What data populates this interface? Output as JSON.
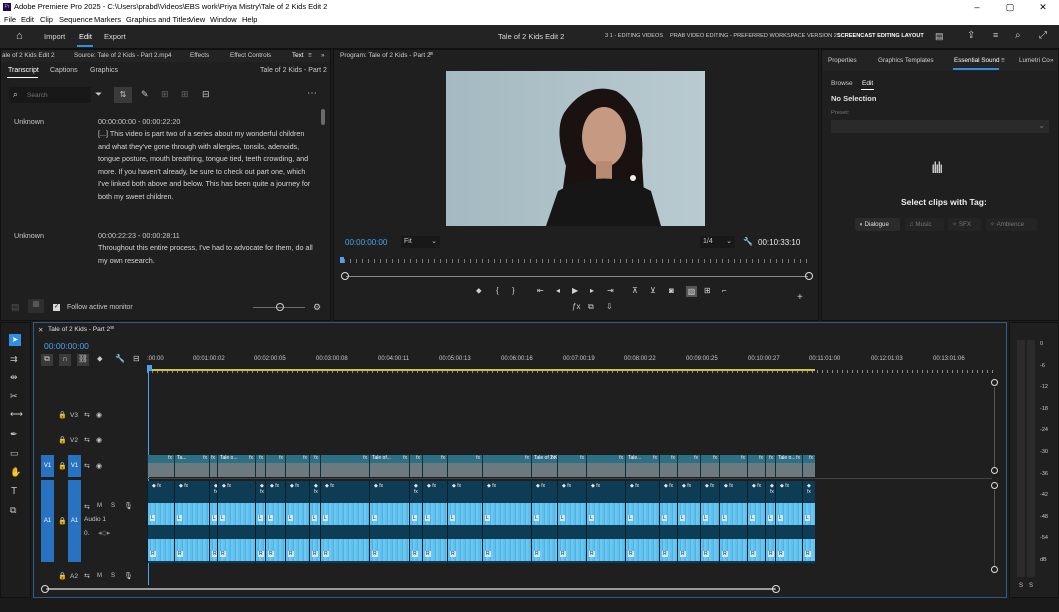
{
  "window": {
    "title": "Adobe Premiere Pro 2025 - C:\\Users\\prabd\\Videos\\EBS work\\Priya Mistry\\Tale of 2 Kids Edit 2",
    "min": "–",
    "max": "▢",
    "close": "✕"
  },
  "menu": [
    "File",
    "Edit",
    "Clip",
    "Sequence",
    "Markers",
    "Graphics and Titles",
    "View",
    "Window",
    "Help"
  ],
  "header": {
    "tabs": [
      "Import",
      "Edit",
      "Export"
    ],
    "active_tab": "Edit",
    "project_title": "Tale of 2 Kids Edit 2",
    "workspaces": [
      "3 1 - EDITING VIDEOS",
      "PRAB VIDEO EDITING - PREFERRED WORKSPACE VERSION 2",
      "SCREENCAST EDITING LAYOUT"
    ],
    "active_workspace": "SCREENCAST EDITING LAYOUT"
  },
  "source_panel": {
    "tabs": [
      "ale of 2 Kids Edit 2",
      "Source: Tale of 2 Kids - Part 2.mp4",
      "Effects",
      "Effect Controls",
      "Text"
    ],
    "sub_tabs": [
      "Transcript",
      "Captions",
      "Graphics"
    ],
    "sequence_name": "Tale of 2 Kids - Part 2",
    "search_placeholder": "Search",
    "entries": [
      {
        "speaker": "Unknown",
        "time": "00:00:00:00 - 00:00:22:20",
        "text": "[...] This video is part two of a series about my wonderful children and what they've gone through with allergies, tonsils, adenoids, tongue posture, mouth breathing, tongue tied, teeth crowding, and more. If you haven't already, be sure to check out part one, which I've linked both above and below. This has been quite a journey for both my sweet children."
      },
      {
        "speaker": "Unknown",
        "time": "00:00:22:23 - 00:00:28:11",
        "text": "Throughout this entire process, I've had to advocate for them, do all my own research."
      }
    ],
    "follow_label": "Follow active monitor"
  },
  "program": {
    "title": "Program: Tale of 2 Kids - Part 2",
    "timecode": "00:00:00:00",
    "fit": "Fit",
    "resolution": "1/4",
    "duration": "00:10:33:10",
    "playhead_fraction": 0.0
  },
  "essential_sound": {
    "tabs": [
      "Properties",
      "Graphics Templates",
      "Essential Sound",
      "Lumetri Co"
    ],
    "sub_tabs": [
      "Browse",
      "Edit"
    ],
    "selection": "No Selection",
    "preset_label": "Preset:",
    "heading": "Select clips with Tag:",
    "tags": [
      "Dialogue",
      "Music",
      "SFX",
      "Ambience"
    ]
  },
  "timeline": {
    "sequence_tab": "Tale of 2 Kids - Part 2",
    "timecode": "00:00:00:00",
    "ruler": [
      ":00:00",
      "00:01:00:02",
      "00:02:00:05",
      "00:03:00:08",
      "00:04:00:11",
      "00:05:00:13",
      "00:06:00:16",
      "00:07:00:19",
      "00:08:00:22",
      "00:09:00:25",
      "00:10:00:27",
      "00:11:01:00",
      "00:12:01:03",
      "00:13:01:06"
    ],
    "tracks_video": [
      "V3",
      "V2",
      "V1"
    ],
    "tracks_audio": [
      "A1",
      "A2"
    ],
    "audio1_name": "Audio 1",
    "audio1_value": "0.",
    "source_patch_v": "V1",
    "source_patch_a": "A1",
    "lock_label": "🔒",
    "mute_label": "M",
    "solo_label": "S",
    "clip_labels": [
      "Ta...",
      "Tale o...",
      "Tale of...",
      "Tale of 2 Kids - P...",
      "Tale...",
      "Tale o..."
    ]
  },
  "meter": {
    "scale": [
      "0",
      "-6",
      "-12",
      "-18",
      "-24",
      "-30",
      "-36",
      "-42",
      "-48",
      "-54",
      "dB"
    ],
    "solo": [
      "S",
      "S"
    ]
  },
  "colors": {
    "accent": "#2f8fe0",
    "video_clip": "#2a6c80",
    "audio_clip": "#5fc0ec",
    "audio_dark": "#0c3a52",
    "workspace_active": "#ffffff",
    "playhead": "#4aa3f0"
  }
}
